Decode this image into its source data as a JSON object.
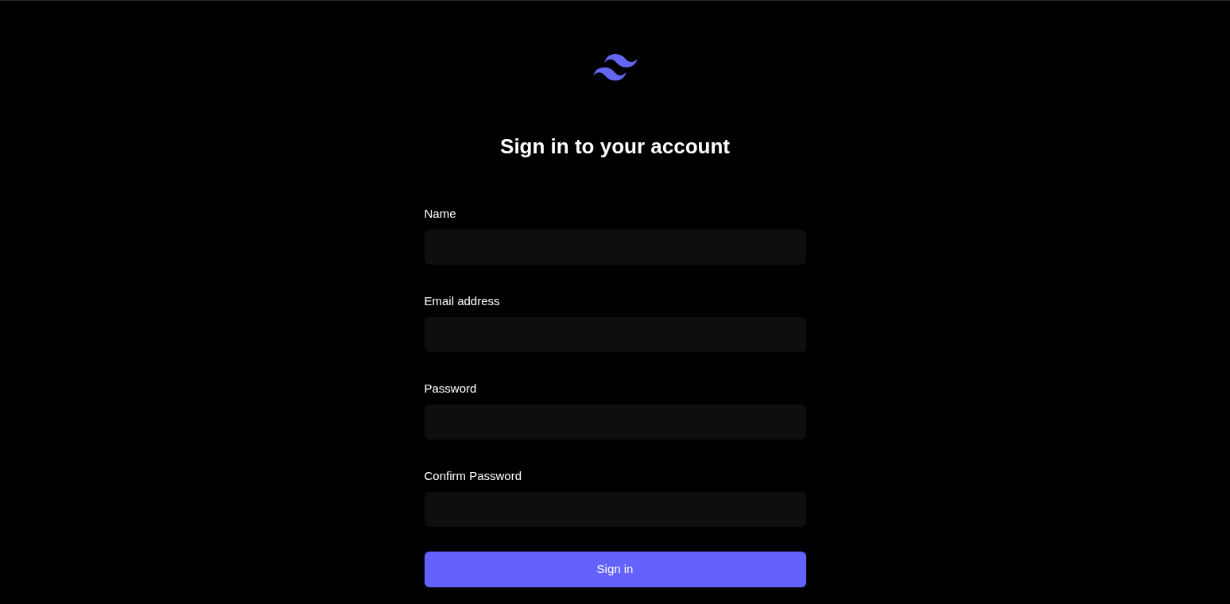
{
  "heading": "Sign in to your account",
  "fields": [
    {
      "label": "Name"
    },
    {
      "label": "Email address"
    },
    {
      "label": "Password"
    },
    {
      "label": "Confirm Password"
    }
  ],
  "submit_button": "Sign in"
}
